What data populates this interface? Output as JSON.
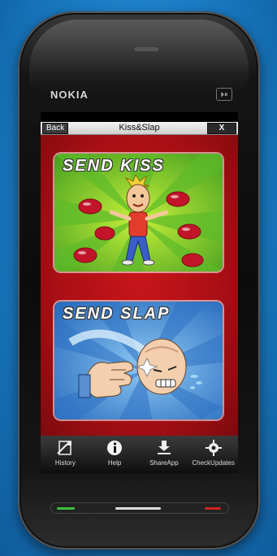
{
  "device": {
    "brand": "NOKIA",
    "media_key_label": "⏵⏸"
  },
  "app": {
    "title": "Kiss&Slap",
    "back_label": "Back",
    "close_label": "X"
  },
  "cards": {
    "kiss": {
      "label": "SEND KISS"
    },
    "slap": {
      "label": "SEND SLAP"
    }
  },
  "toolbar": {
    "items": [
      {
        "label": "History",
        "icon": "history-icon"
      },
      {
        "label": "Help",
        "icon": "info-icon"
      },
      {
        "label": "ShareApp",
        "icon": "download-icon"
      },
      {
        "label": "CheckUpdates",
        "icon": "gear-icon"
      }
    ]
  },
  "colors": {
    "content_red": "#c8151b",
    "kiss_green": "#6fc22f",
    "slap_blue": "#2f7fd0",
    "call_key": "#3fbf3f",
    "end_key": "#d02323"
  }
}
